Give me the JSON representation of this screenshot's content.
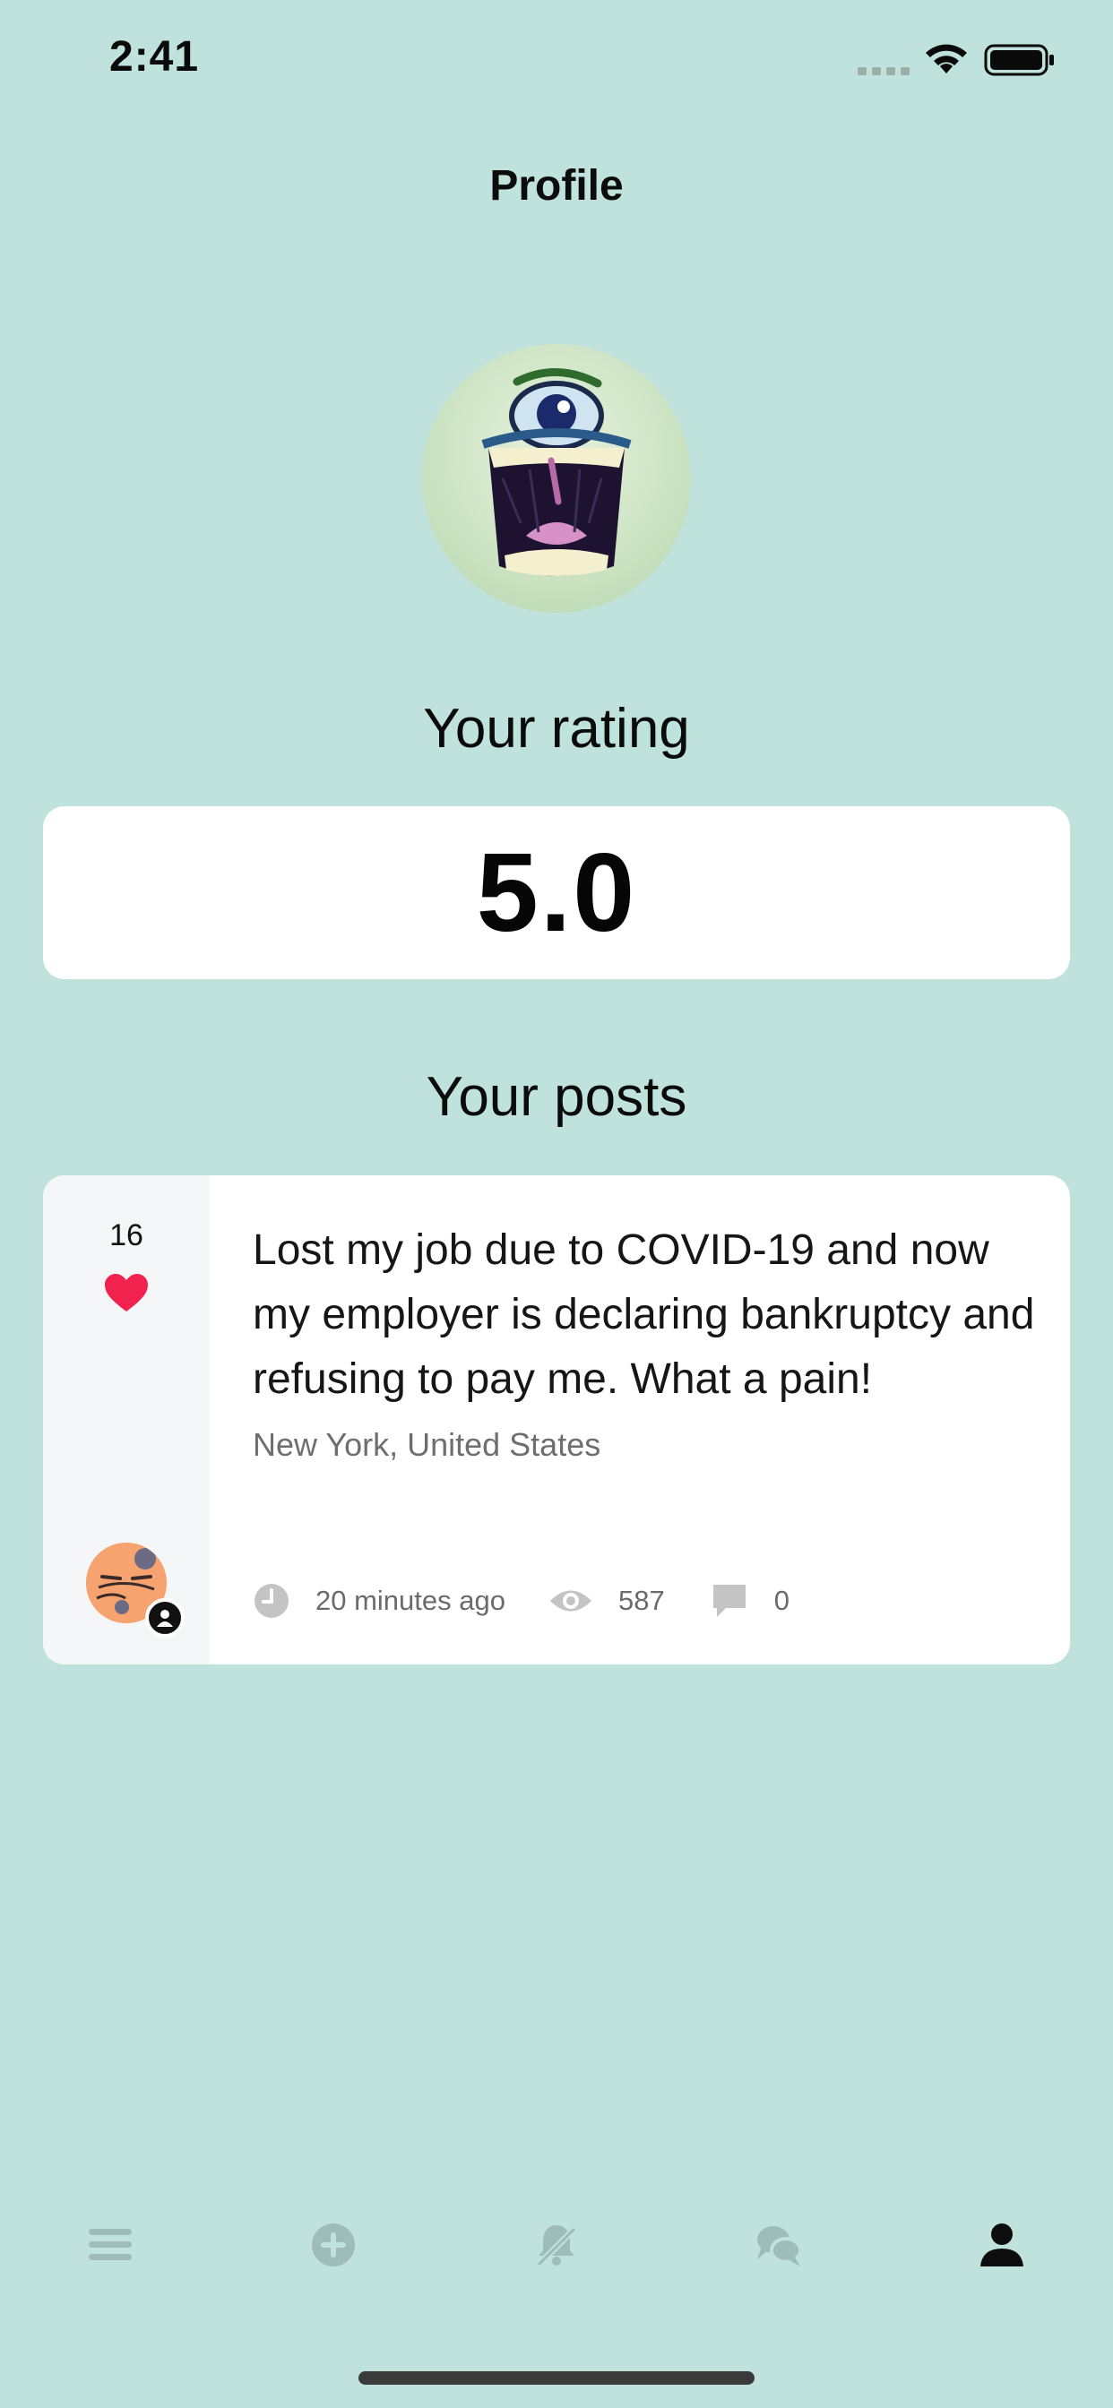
{
  "status_bar": {
    "time": "2:41",
    "signal_icon": "signal-dots-icon",
    "wifi_icon": "wifi-icon",
    "battery_icon": "battery-icon"
  },
  "header": {
    "title": "Profile"
  },
  "profile": {
    "avatar": "monster-avatar"
  },
  "rating": {
    "title": "Your rating",
    "value": "5.0"
  },
  "posts": {
    "title": "Your posts",
    "items": [
      {
        "likes": "16",
        "text": "Lost my job due to COVID-19 and now my employer is declaring bankruptcy and refusing to pay me. What a pain!",
        "location": "New York, United States",
        "time": "20 minutes ago",
        "views": "587",
        "comments": "0",
        "author_avatar": "orange-face-avatar"
      }
    ]
  },
  "tab_bar": {
    "items": [
      {
        "icon": "menu-icon",
        "active": false
      },
      {
        "icon": "add-circle-icon",
        "active": false
      },
      {
        "icon": "bell-off-icon",
        "active": false
      },
      {
        "icon": "chat-bubbles-icon",
        "active": false
      },
      {
        "icon": "person-icon",
        "active": true
      }
    ]
  },
  "colors": {
    "background": "#bfe2dd",
    "card": "#ffffff",
    "heart": "#f2224f",
    "tab_inactive": "#9fbdb8",
    "tab_active": "#0d0d0d"
  }
}
